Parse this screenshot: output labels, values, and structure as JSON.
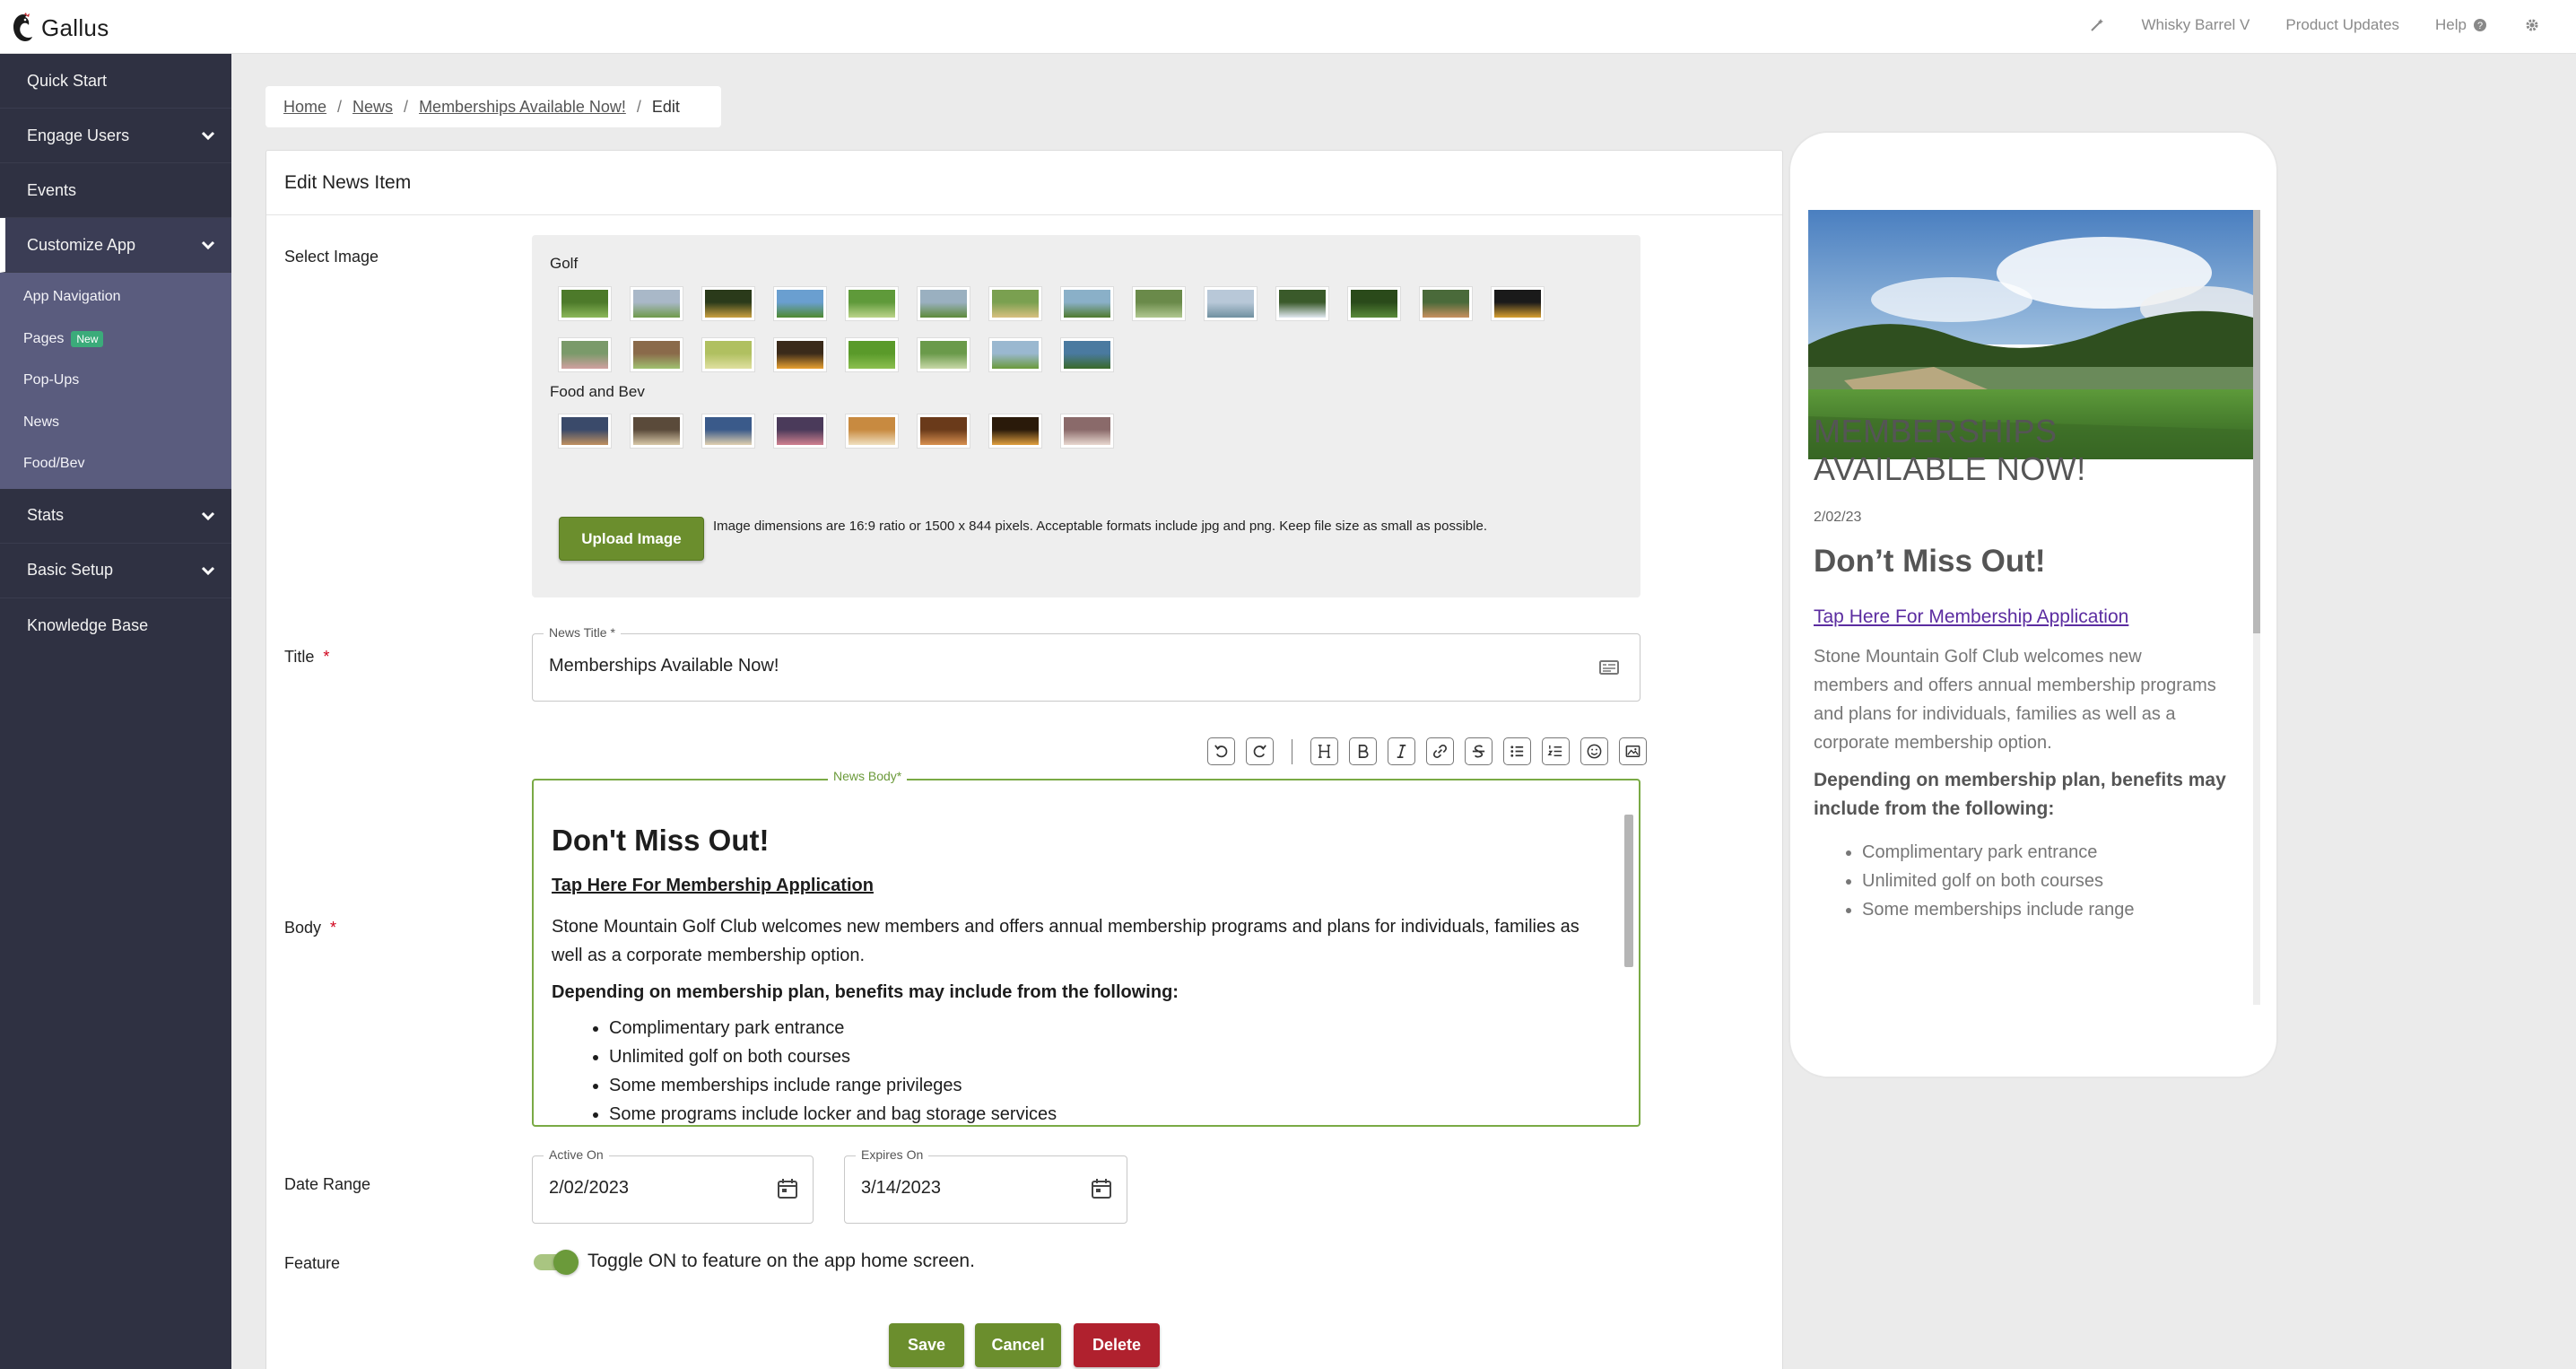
{
  "app": {
    "name": "Gallus"
  },
  "topnav": {
    "account": "Whisky Barrel V",
    "updates": "Product Updates",
    "help": "Help"
  },
  "sidebar": {
    "quick_start": "Quick Start",
    "engage_users": "Engage Users",
    "events": "Events",
    "customize_app": "Customize App",
    "sub": {
      "app_navigation": "App Navigation",
      "pages": "Pages",
      "pages_badge": "New",
      "popups": "Pop-Ups",
      "news": "News",
      "foodbev": "Food/Bev"
    },
    "stats": "Stats",
    "basic_setup": "Basic Setup",
    "knowledge_base": "Knowledge Base"
  },
  "breadcrumb": {
    "home": "Home",
    "news": "News",
    "item": "Memberships Available Now!",
    "current": "Edit",
    "sep": "/"
  },
  "form": {
    "header": "Edit News Item",
    "select_image_label": "Select Image",
    "golf_group": "Golf",
    "food_group": "Food and Bev",
    "upload_button": "Upload Image",
    "upload_hint": "Image dimensions are 16:9 ratio or 1500 x 844 pixels. Acceptable formats include jpg and png. Keep file size as small as possible.",
    "title_label": "Title",
    "required_mark": "*",
    "title_legend": "News Title *",
    "title_value": "Memberships Available Now!",
    "body_label": "Body",
    "body_legend": "News Body*",
    "body": {
      "heading": "Don't Miss Out!",
      "link": "Tap Here For Membership Application",
      "paragraph": "Stone Mountain Golf Club welcomes new members and offers annual membership programs and plans for individuals, families as well as a corporate membership option.",
      "strong": "Depending on membership plan, benefits may include from the following:",
      "list": [
        "Complimentary park entrance",
        "Unlimited golf on both courses",
        "Some memberships include range privileges",
        "Some programs include locker and bag storage services"
      ]
    },
    "date_label": "Date Range",
    "active_legend": "Active On",
    "active_value": "2/02/2023",
    "expires_legend": "Expires On",
    "expires_value": "3/14/2023",
    "feature_label": "Feature",
    "feature_text": "Toggle ON to feature on the app home screen.",
    "feature_on": true,
    "save": "Save",
    "cancel": "Cancel",
    "delete": "Delete"
  },
  "preview": {
    "title": "MEMBERSHIPS AVAILABLE NOW!",
    "date": "2/02/23",
    "heading": "Don’t Miss Out!",
    "link": "Tap Here For Membership Application",
    "paragraph": "Stone Mountain Golf Club welcomes new members and offers annual membership programs and plans for individuals, families as well as a corporate membership option.",
    "strong": "Depending on membership plan, benefits may include from the following:",
    "list": [
      "Complimentary park entrance",
      "Unlimited golf on both courses",
      "Some memberships include range"
    ]
  },
  "colors": {
    "sidebar": "#2f3142",
    "submenu": "#5a5c7e",
    "accent_green": "#6b8e2d",
    "danger": "#b0212e"
  },
  "icons": [
    "chevron-down-icon",
    "undo-icon",
    "redo-icon",
    "heading-icon",
    "bold-icon",
    "italic-icon",
    "link-icon",
    "strikethrough-icon",
    "bullet-list-icon",
    "numbered-list-icon",
    "emoji-icon",
    "image-icon",
    "calendar-icon",
    "gear-icon",
    "help-icon",
    "wand-icon"
  ]
}
